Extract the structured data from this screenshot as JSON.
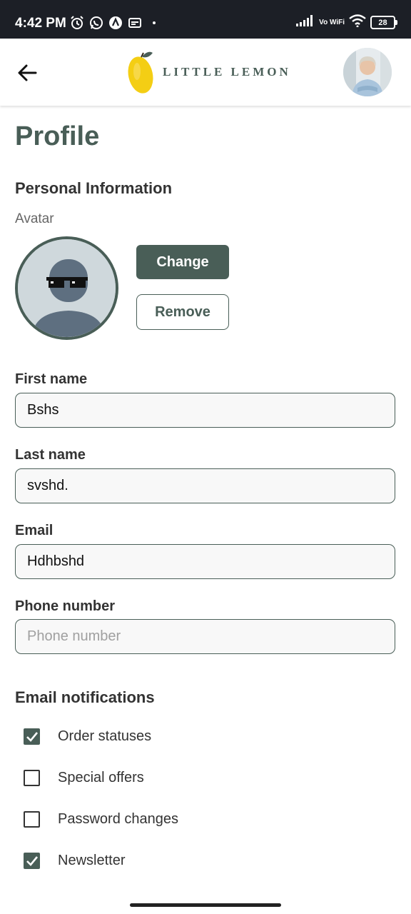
{
  "status_bar": {
    "time": "4:42 PM",
    "left_icons": [
      "alarm-icon",
      "whatsapp-icon",
      "app-icon",
      "media-icon"
    ],
    "network_label": "Vo WiFi",
    "battery": "28"
  },
  "header": {
    "logo_text": "LITTLE LEMON",
    "back_icon": "arrow-left-icon",
    "profile_avatar": "user-photo"
  },
  "profile": {
    "title": "Profile",
    "personal_info_title": "Personal Information",
    "avatar_label": "Avatar",
    "change_label": "Change",
    "remove_label": "Remove"
  },
  "form": {
    "first_name": {
      "label": "First name",
      "value": "Bshs"
    },
    "last_name": {
      "label": "Last name",
      "value": "svshd."
    },
    "email": {
      "label": "Email",
      "value": "Hdhbshd"
    },
    "phone": {
      "label": "Phone number",
      "value": "",
      "placeholder": "Phone number"
    }
  },
  "notifications": {
    "title": "Email notifications",
    "items": [
      {
        "label": "Order statuses",
        "checked": true
      },
      {
        "label": "Special offers",
        "checked": false
      },
      {
        "label": "Password changes",
        "checked": false
      },
      {
        "label": "Newsletter",
        "checked": true
      }
    ]
  },
  "colors": {
    "primary": "#495e57",
    "lemon": "#f4ce14",
    "status_bar": "#1c1f26"
  }
}
